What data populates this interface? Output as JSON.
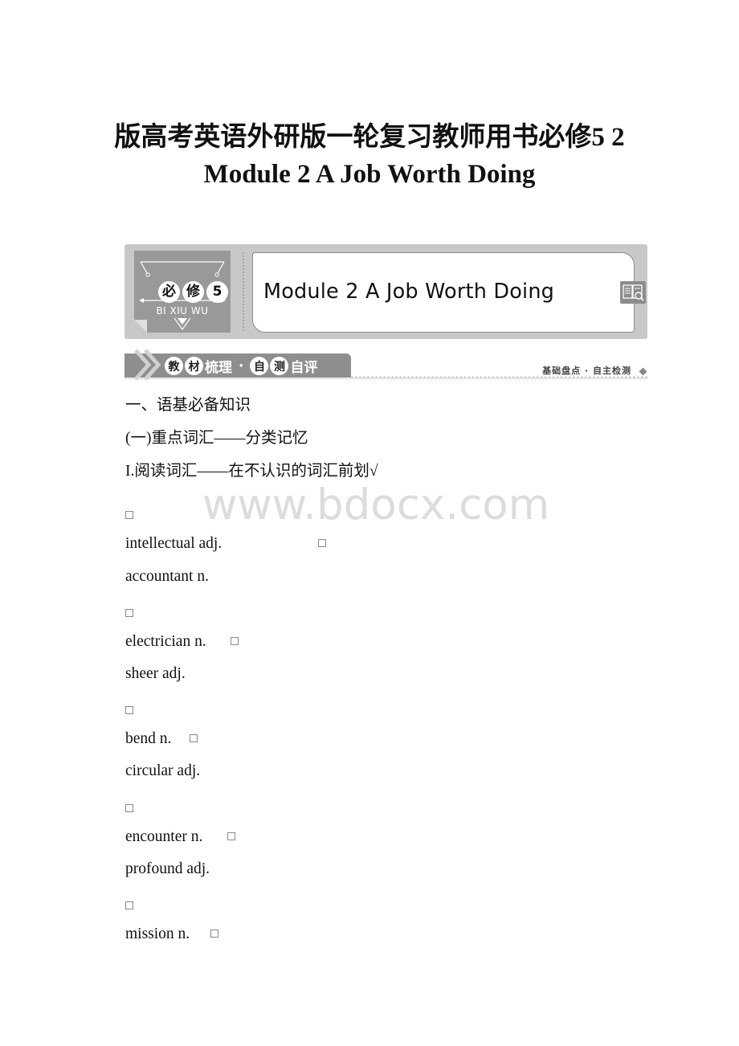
{
  "document": {
    "title_line1": "版高考英语外研版一轮复习教师用书必修5 2",
    "title_line2": "Module 2 A Job Worth Doing"
  },
  "banner": {
    "badge": {
      "chars": [
        "必",
        "修",
        "5"
      ],
      "pinyin": "BI XIU WU"
    },
    "module_title": "Module 2  A Job Worth Doing",
    "icon": "book-search-icon"
  },
  "section_bar": {
    "tab_circled": [
      "教",
      "材"
    ],
    "tab_text_1": "梳理",
    "tab_dot": "·",
    "tab_circled_2": [
      "自",
      "测"
    ],
    "tab_text_2": "自评",
    "right_label": "基础盘点 · 自主检测"
  },
  "content": {
    "heading1": "一、语基必备知识",
    "heading2": "(一)重点词汇——分类记忆",
    "heading3": "I.阅读词汇——在不认识的词汇前划√",
    "vocab": [
      {
        "word": "intellectual adj."
      },
      {
        "word": "accountant n."
      },
      {
        "word": "electrician n."
      },
      {
        "word": "sheer adj."
      },
      {
        "word": "bend n."
      },
      {
        "word": "circular adj."
      },
      {
        "word": "encounter n."
      },
      {
        "word": "profound adj."
      },
      {
        "word": "mission n."
      }
    ]
  },
  "watermark": "www.bdocx.com"
}
